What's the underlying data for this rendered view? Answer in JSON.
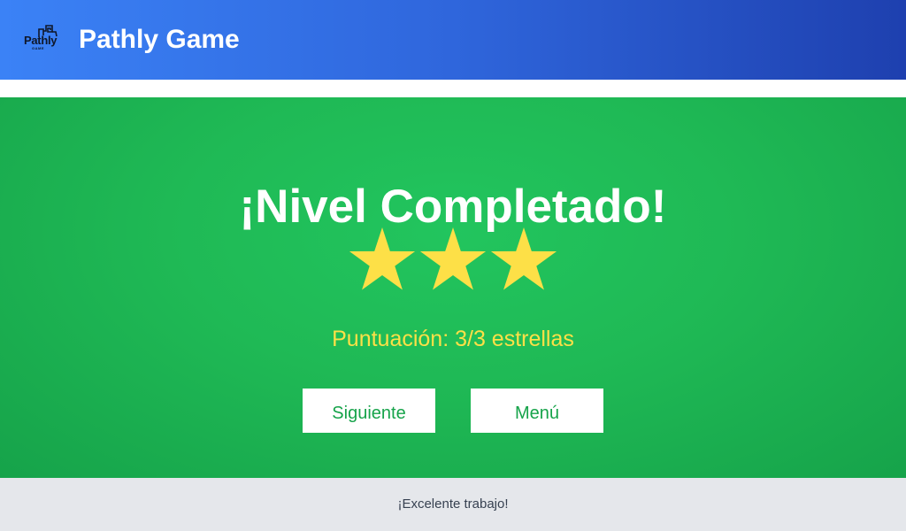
{
  "header": {
    "logo_text": "Pathly",
    "logo_subtext": "GAME",
    "title": "Pathly Game"
  },
  "result": {
    "title": "¡Nivel Completado!",
    "stars_earned": 3,
    "stars_total": 3,
    "score_text": "Puntuación: 3/3 estrellas",
    "star_color": "#fde047"
  },
  "actions": {
    "next_label": "Siguiente",
    "menu_label": "Menú"
  },
  "footer": {
    "message": "¡Excelente trabajo!"
  },
  "colors": {
    "header_start": "#3b82f6",
    "header_end": "#1e40af",
    "panel_green": "#22c55e",
    "panel_green_dark": "#16a34a",
    "footer_bg": "#e5e7eb"
  }
}
